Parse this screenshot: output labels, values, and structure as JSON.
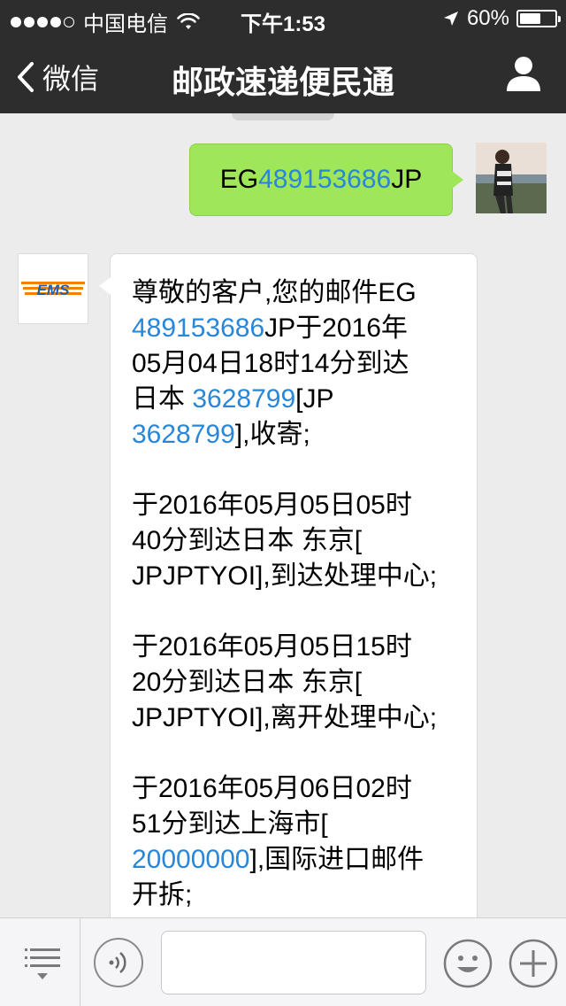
{
  "status_bar": {
    "carrier": "中国电信",
    "time": "下午1:53",
    "battery_percent": "60%",
    "battery_level": 0.6
  },
  "nav": {
    "back_label": "微信",
    "title": "邮政速递便民通"
  },
  "messages": {
    "outgoing": {
      "prefix": "EG",
      "number": "489153686",
      "suffix": "JP"
    },
    "incoming": {
      "sender_logo_text": "EMS",
      "lines": {
        "l1": "尊敬的客户,您的邮件EG",
        "l2_link": "489153686",
        "l2_text": "JP于2016年",
        "l3": "05月04日18时14分到达",
        "l4_text": "日本 ",
        "l4_link": "3628799",
        "l4_tail": "[JP",
        "l5_link": "3628799",
        "l5_text": "],收寄;",
        "p2_l1": "于2016年05月05日05时",
        "p2_l2": "40分到达日本 东京[",
        "p2_l3": "JPJPTYOI],到达处理中心;",
        "p3_l1": "于2016年05月05日15时",
        "p3_l2": "20分到达日本 东京[",
        "p3_l3": "JPJPTYOI],离开处理中心;",
        "p4_l1": "于2016年05月06日02时",
        "p4_l2": "51分到达上海市[",
        "p4_l3_link": "20000000",
        "p4_l3_text": "],国际进口邮件",
        "p4_l4": "开拆;"
      }
    }
  },
  "input_bar": {
    "text_value": ""
  },
  "colors": {
    "bar_dark": "#2d2d2d",
    "chat_bg": "#ececec",
    "outgoing_bubble": "#9fe658",
    "link": "#2a86d8",
    "ems_orange": "#f08300",
    "ems_blue": "#1f5fb0"
  },
  "icons": {
    "back": "chevron-left-icon",
    "profile": "person-icon",
    "menu": "list-menu-icon",
    "voice": "voice-icon",
    "emoji": "emoji-icon",
    "plus": "plus-icon",
    "wifi": "wifi-icon",
    "location": "location-arrow-icon"
  }
}
